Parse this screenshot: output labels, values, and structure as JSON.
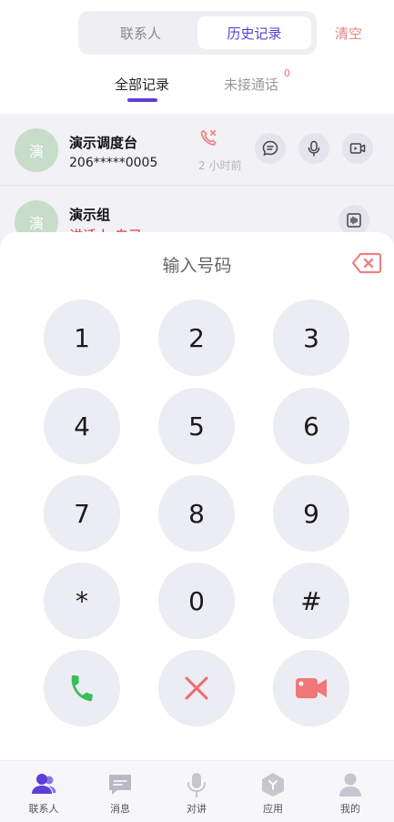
{
  "header": {
    "tabs": [
      {
        "label": "联系人",
        "active": false
      },
      {
        "label": "历史记录",
        "active": true
      }
    ],
    "clear_label": "清空"
  },
  "subtabs": {
    "all_label": "全部记录",
    "missed_label": "未接通话",
    "missed_count": "0"
  },
  "records": [
    {
      "avatar_text": "演",
      "name": "演示调度台",
      "number": "206*****0005",
      "time": "2 小时前",
      "call_type_icon": "missed-call-icon",
      "actions": [
        "message-icon",
        "microphone-icon",
        "video-call-icon"
      ]
    },
    {
      "avatar_text": "演",
      "name": "演示组",
      "status": "讲话人:自己",
      "actions": [
        "intercom-icon"
      ]
    }
  ],
  "dialpad": {
    "placeholder": "输入号码",
    "keys": [
      "1",
      "2",
      "3",
      "4",
      "5",
      "6",
      "7",
      "8",
      "9",
      "*",
      "0",
      "#"
    ],
    "actions": [
      "call-icon",
      "cancel-icon",
      "video-icon"
    ]
  },
  "bottom_nav": [
    {
      "label": "联系人",
      "icon": "contacts-icon",
      "active": true
    },
    {
      "label": "消息",
      "icon": "message-icon",
      "active": false
    },
    {
      "label": "对讲",
      "icon": "intercom-mic-icon",
      "active": false
    },
    {
      "label": "应用",
      "icon": "apps-icon",
      "active": false
    },
    {
      "label": "我的",
      "icon": "profile-icon",
      "active": false
    }
  ],
  "colors": {
    "accent": "#5b3fd6",
    "danger": "#e52a2a",
    "call_green": "#34c05a",
    "video_red": "#f07878",
    "avatar_bg": "#c7dcc9"
  }
}
